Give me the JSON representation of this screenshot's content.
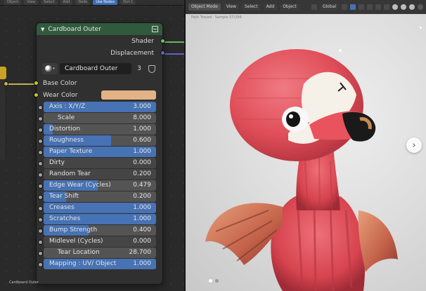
{
  "node_editor": {
    "top_bar": [
      "Object",
      "View",
      "Select",
      "Add",
      "Node",
      "Use Nodes",
      "Slot 1"
    ],
    "node": {
      "title": "Cardboard Outer",
      "outputs": [
        "Shader",
        "Displacement"
      ],
      "group_name": "Cardboard Outer",
      "users": "3",
      "inputs": {
        "base_color": "Base Color",
        "wear_color": "Wear Color",
        "wear_color_hex": "#e3b386"
      },
      "fields": [
        {
          "label": "Axis : X/Y/Z",
          "value": "3.000",
          "fill": 1.0,
          "sunk": false
        },
        {
          "label": "Scale",
          "value": "8.000",
          "fill": 0,
          "sunk": false
        },
        {
          "label": "Distortion",
          "value": "1.000",
          "fill": 0.08,
          "sunk": false
        },
        {
          "label": "Roughness",
          "value": "0.600",
          "fill": 0.6,
          "sunk": false
        },
        {
          "label": "Paper Texture",
          "value": "1.000",
          "fill": 1.0,
          "sunk": false
        },
        {
          "label": "Dirty",
          "value": "0.000",
          "fill": 0,
          "sunk": true
        },
        {
          "label": "Random Tear",
          "value": "0.200",
          "fill": 0,
          "sunk": true
        },
        {
          "label": "Edge Wear (Cycles)",
          "value": "0.479",
          "fill": 0.479,
          "sunk": false
        },
        {
          "label": "Tear Shift",
          "value": "0.200",
          "fill": 0.2,
          "sunk": false
        },
        {
          "label": "Creases",
          "value": "1.000",
          "fill": 1.0,
          "sunk": false
        },
        {
          "label": "Scratches",
          "value": "1.000",
          "fill": 1.0,
          "sunk": false
        },
        {
          "label": "Bump Strength",
          "value": "0.400",
          "fill": 0.4,
          "sunk": false
        },
        {
          "label": "Midlevel (Cycles)",
          "value": "0.000",
          "fill": 0,
          "sunk": true
        },
        {
          "label": "Tear Location",
          "value": "28.700",
          "fill": 0,
          "sunk": false
        },
        {
          "label": "Mapping : UV/ Object",
          "value": "1.000",
          "fill": 1.0,
          "sunk": false
        }
      ],
      "footer_label": "Cardboard Outer"
    }
  },
  "viewport": {
    "header": {
      "mode": "Object Mode",
      "menus": [
        "View",
        "Select",
        "Add",
        "Object"
      ],
      "transform": "Global"
    },
    "info_text": "Path Traced  ·  Sample 57/256",
    "pager": {
      "count": 2,
      "active": 0
    },
    "next_icon": "chevron-right-icon"
  },
  "colors": {
    "node_header": "#315a3d",
    "field_fill": "#4772b3",
    "shader_socket": "#63c763",
    "displacement_socket": "#6363c7",
    "color_socket": "#c7c729",
    "flamingo_red": "#e8505b"
  }
}
